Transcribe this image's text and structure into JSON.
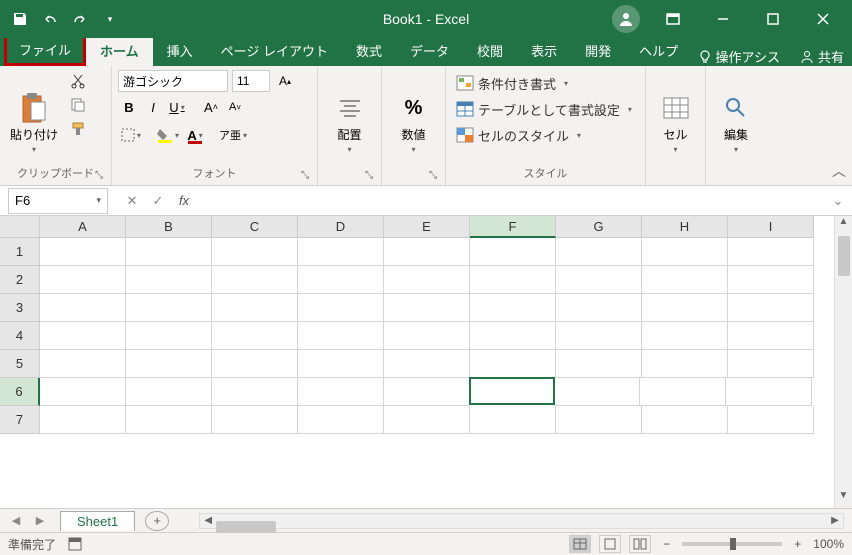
{
  "title": "Book1 - Excel",
  "tabs": {
    "file": "ファイル",
    "home": "ホーム",
    "insert": "挿入",
    "page_layout": "ページ レイアウト",
    "formulas": "数式",
    "data": "データ",
    "review": "校閲",
    "view": "表示",
    "developer": "開発",
    "help": "ヘルプ",
    "tell_me": "操作アシス",
    "share": "共有"
  },
  "ribbon": {
    "clipboard": {
      "label": "クリップボード",
      "paste": "貼り付け"
    },
    "font": {
      "label": "フォント",
      "name": "游ゴシック",
      "size": "11",
      "bold": "B",
      "italic": "I",
      "underline": "U",
      "ruby": "ア亜"
    },
    "alignment": {
      "label": "配置"
    },
    "number": {
      "label": "数値"
    },
    "styles": {
      "label": "スタイル",
      "conditional": "条件付き書式",
      "table": "テーブルとして書式設定",
      "cell_styles": "セルのスタイル"
    },
    "cells": {
      "label": "セル"
    },
    "editing": {
      "label": "編集"
    }
  },
  "namebox": "F6",
  "formula": "",
  "columns": [
    "A",
    "B",
    "C",
    "D",
    "E",
    "F",
    "G",
    "H",
    "I"
  ],
  "rows": [
    "1",
    "2",
    "3",
    "4",
    "5",
    "6",
    "7"
  ],
  "active_cell": {
    "row": 5,
    "col": 5
  },
  "sheet_tab": "Sheet1",
  "status": {
    "ready": "準備完了",
    "zoom": "100%"
  }
}
